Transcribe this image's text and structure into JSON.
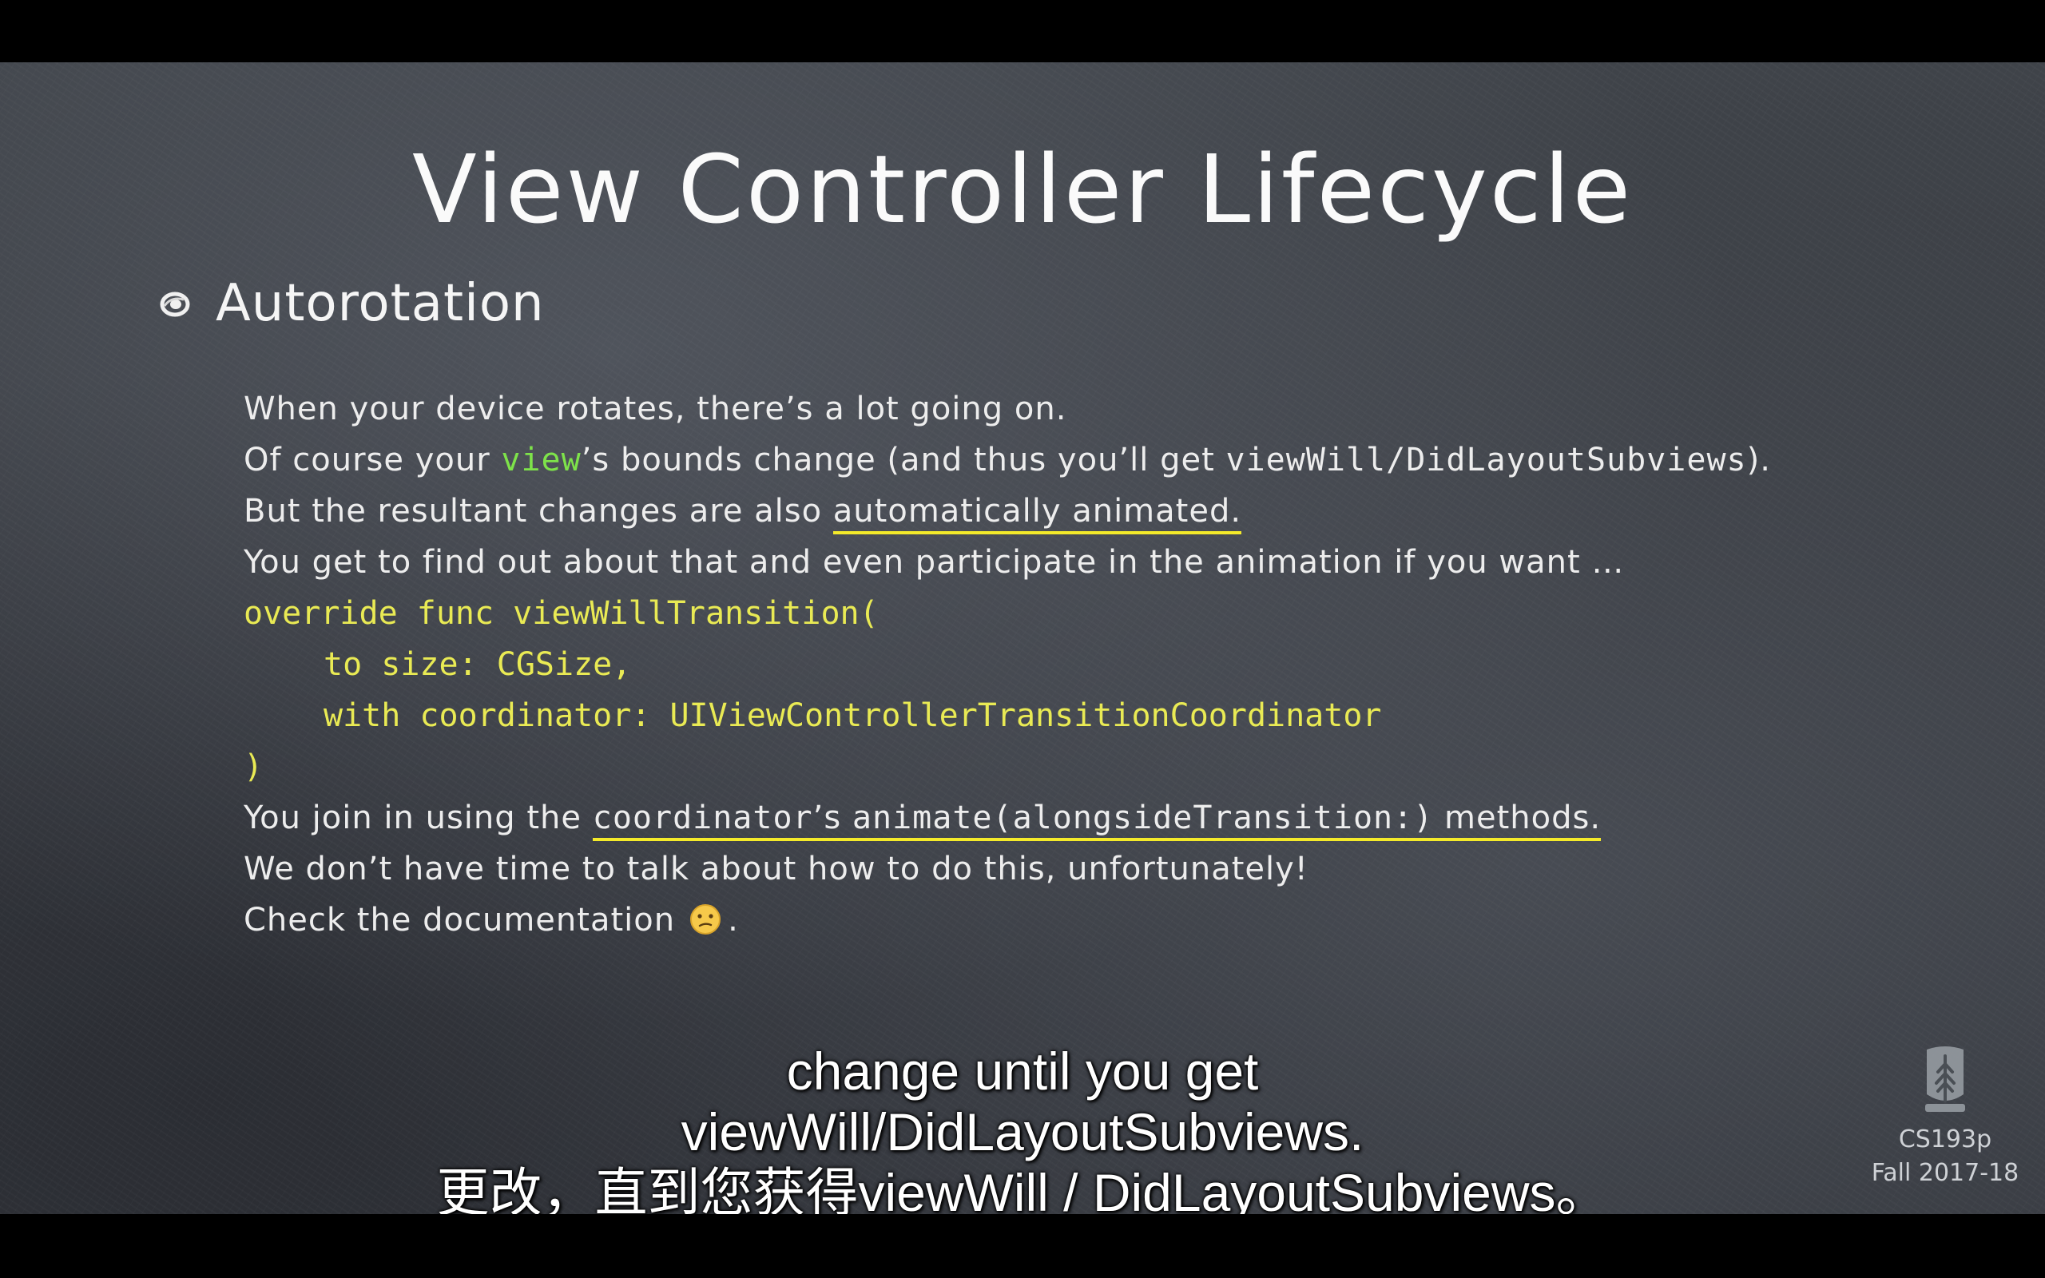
{
  "slide": {
    "title": "View Controller Lifecycle",
    "bullet": "Autorotation",
    "lines": {
      "l1": "When your device rotates, there’s a lot going on.",
      "l2_pre": "Of course your ",
      "l2_view": "view",
      "l2_post": "’s bounds change (and thus you’ll get ",
      "l2_code": "viewWill/DidLayoutSubviews",
      "l2_end": ").",
      "l3_pre": "But the resultant changes are also ",
      "l3_ul": "automatically animated.",
      "l4": "You get to find out about that and even participate in the animation if you want …",
      "code1": "override func viewWillTransition(",
      "code2": "to size: CGSize,",
      "code3": "with coordinator: UIViewControllerTransitionCoordinator",
      "code4": ")",
      "l5_pre": "You join in using the ",
      "l5_code1": "coordinator",
      "l5_mid": "’s ",
      "l5_code2": "animate(alongsideTransition:)",
      "l5_end": " methods.",
      "l6": "We don’t have time to talk about how to do this, unfortunately!",
      "l7_pre": "Check the documentation",
      "l7_end": "."
    },
    "emoji_icon": "confused-face-icon"
  },
  "subtitles": {
    "en_line1": "change until you get",
    "en_line2": "viewWill/DidLayoutSubviews.",
    "cn_line": "更改，直到您获得viewWill / DidLayoutSubviews。"
  },
  "branding": {
    "logo_icon": "stanford-tree-logo",
    "course": "CS193p",
    "term": "Fall 2017-18"
  },
  "colors": {
    "board": "#3b3e44",
    "code_yellow": "#e9ea54",
    "view_green": "#7ee34a",
    "underline_yellow": "#f4ea2a"
  }
}
